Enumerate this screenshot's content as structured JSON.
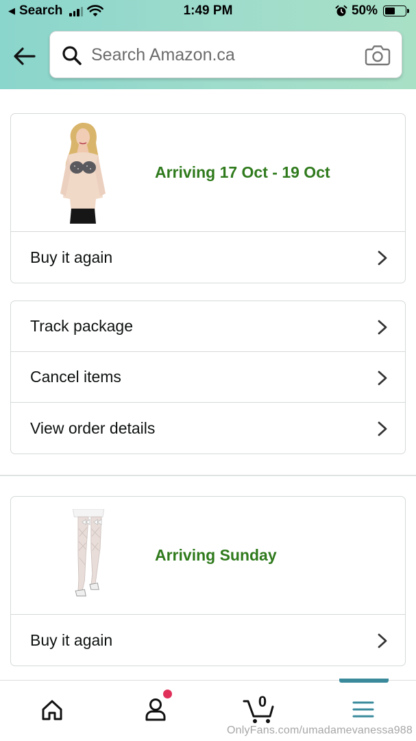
{
  "status_bar": {
    "back_label": "Search",
    "time": "1:49 PM",
    "battery": "50%",
    "battery_level": 0.5
  },
  "search": {
    "placeholder": "Search Amazon.ca"
  },
  "orders": [
    {
      "arriving": "Arriving 17 Oct - 19 Oct",
      "product_image": "mesh-long-sleeve-top-model-photo",
      "buy_again": "Buy it again"
    },
    {
      "arriving": "Arriving Sunday",
      "product_image": "fishnet-stockings-bow-photo",
      "buy_again": "Buy it again"
    }
  ],
  "actions": {
    "track": "Track package",
    "cancel": "Cancel items",
    "details": "View order details"
  },
  "bottom_nav": {
    "items": [
      "home-icon",
      "account-icon",
      "cart-icon",
      "menu-icon"
    ],
    "cart_count": "0",
    "active_index": 3
  },
  "colors": {
    "header_gradient_start": "#8ad5cc",
    "header_gradient_end": "#a8e0c6",
    "arriving_green": "#2f7a1c",
    "active_nav": "#3a8a9c",
    "notification_dot": "#e0305a"
  },
  "watermark": "OnlyFans.com/umadamevanessa988"
}
